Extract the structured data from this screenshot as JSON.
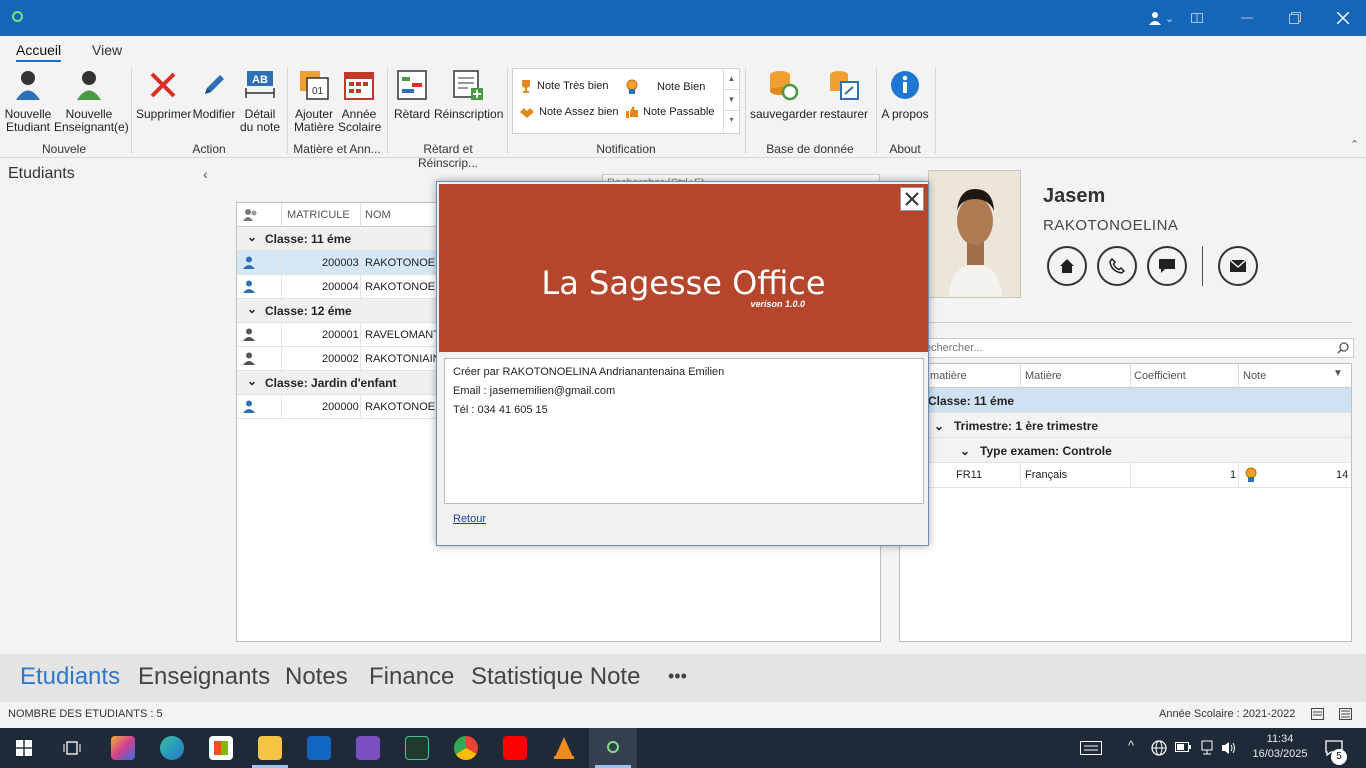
{
  "titlebar": {
    "user_chevron": "⌄"
  },
  "ribbon_tabs": [
    "Accueil",
    "View"
  ],
  "ribbon": {
    "buttons": [
      {
        "label": "Nouvelle\nEtudiant"
      },
      {
        "label": "Nouvelle\nEnseignant(e)"
      },
      {
        "label": "Supprimer"
      },
      {
        "label": "Modifier"
      },
      {
        "label": "Détail\ndu note"
      },
      {
        "label": "Ajouter\nMatière"
      },
      {
        "label": "Année\nScolaire"
      },
      {
        "label": "Rètard"
      },
      {
        "label": "Réinscription"
      },
      {
        "label": "sauvegarder"
      },
      {
        "label": "restaurer"
      },
      {
        "label": "A propos"
      }
    ],
    "groups": [
      "Nouvele",
      "Action",
      "Matière et Ann...",
      "Rètard et Réinscrip...",
      "Notification",
      "Base de donnée",
      "About"
    ],
    "notifications": [
      "Note Très bien",
      "Note Bien",
      "Note Assez bien",
      "Note Passable"
    ]
  },
  "left": {
    "title": "Etudiants",
    "search_placeholder": "Rechercher (Ctrl+F)"
  },
  "grid": {
    "headers": [
      "MATRICULE",
      "NOM"
    ],
    "rows": [
      {
        "type": "group",
        "label": "Classe: 11 éme"
      },
      {
        "type": "row",
        "matricule": "200003",
        "nom": "RAKOTONOELI",
        "selected": true,
        "icon_color": "#2f6fb3"
      },
      {
        "type": "row",
        "matricule": "200004",
        "nom": "RAKOTONOELI",
        "selected": false,
        "icon_color": "#2f6fb3"
      },
      {
        "type": "group",
        "label": "Classe: 12 éme"
      },
      {
        "type": "row",
        "matricule": "200001",
        "nom": "RAVELOMANTS",
        "selected": false,
        "icon_color": "#555555"
      },
      {
        "type": "row",
        "matricule": "200002",
        "nom": "RAKOTONIAINA",
        "selected": false,
        "icon_color": "#555555"
      },
      {
        "type": "group",
        "label": "Classe: Jardin d'enfant"
      },
      {
        "type": "row",
        "matricule": "200000",
        "nom": "RAKOTONOELI",
        "selected": false,
        "icon_color": "#2f6fb3"
      }
    ]
  },
  "profile": {
    "first_name": "Jasem",
    "last_name": "RAKOTONOELINA"
  },
  "right_grid": {
    "search_placeholder": "Rechercher...",
    "headers": [
      "matière",
      "Matière",
      "Coefficient",
      "Note"
    ],
    "group1": "Classe: 11 éme",
    "group2": "Trimestre: 1 ère trimestre",
    "group3": "Type examen: Controle",
    "row": {
      "code": "FR11",
      "matiere": "Français",
      "coefficient": "1",
      "note": "14"
    }
  },
  "dialog": {
    "title": "La Sagesse Office",
    "version": "verison 1.0.0",
    "lines": [
      "Créer par RAKOTONOELINA Andrianantenaina Emilien",
      "Email : jasememilien@gmail.com",
      "Tél : 034 41 605 15"
    ],
    "link": "Retour"
  },
  "bottomnav": [
    "Etudiants",
    "Enseignants",
    "Notes",
    "Finance",
    "Statistique Note",
    "•••"
  ],
  "status": {
    "left": "NOMBRE DES ETUDIANTS : 5",
    "right": "Année Scolaire : 2021-2022"
  },
  "taskbar": {
    "time": "11:34",
    "date": "16/03/2025",
    "notif_count": "5"
  },
  "colors": {
    "titlebar": "#1565b8",
    "accent": "#2f78c9",
    "banner": "#b5452b"
  }
}
